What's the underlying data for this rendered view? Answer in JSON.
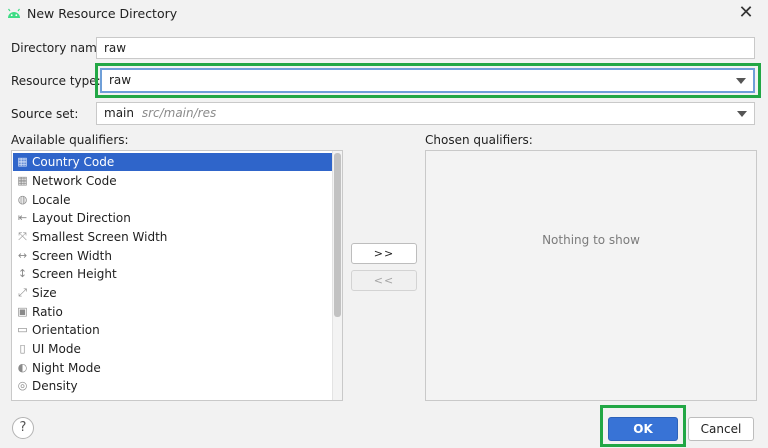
{
  "window": {
    "title": "New Resource Directory",
    "close_glyph": "✕",
    "app_icon": "android-icon"
  },
  "form": {
    "directory_name": {
      "label": "Directory name:",
      "value": "raw"
    },
    "resource_type": {
      "label": "Resource type:",
      "value": "raw"
    },
    "source_set": {
      "label": "Source set:",
      "value": "main",
      "path": "src/main/res"
    }
  },
  "available": {
    "label": "Available qualifiers:",
    "items": [
      {
        "label": "Country Code",
        "icon": "country-code-icon",
        "glyph": "▦",
        "selected": true
      },
      {
        "label": "Network Code",
        "icon": "network-code-icon",
        "glyph": "▦"
      },
      {
        "label": "Locale",
        "icon": "globe-icon",
        "glyph": "◍"
      },
      {
        "label": "Layout Direction",
        "icon": "layout-direction-icon",
        "glyph": "⇤"
      },
      {
        "label": "Smallest Screen Width",
        "icon": "smallest-width-icon",
        "glyph": "⤧"
      },
      {
        "label": "Screen Width",
        "icon": "screen-width-icon",
        "glyph": "↔"
      },
      {
        "label": "Screen Height",
        "icon": "screen-height-icon",
        "glyph": "↕"
      },
      {
        "label": "Size",
        "icon": "size-icon",
        "glyph": "⤢"
      },
      {
        "label": "Ratio",
        "icon": "ratio-icon",
        "glyph": "▣"
      },
      {
        "label": "Orientation",
        "icon": "orientation-icon",
        "glyph": "▭"
      },
      {
        "label": "UI Mode",
        "icon": "ui-mode-icon",
        "glyph": "▯"
      },
      {
        "label": "Night Mode",
        "icon": "night-mode-icon",
        "glyph": "◐"
      },
      {
        "label": "Density",
        "icon": "density-icon",
        "glyph": "◎"
      }
    ]
  },
  "move": {
    "add_label": ">>",
    "remove_label": "<<"
  },
  "chosen": {
    "label": "Chosen qualifiers:",
    "empty_text": "Nothing to show"
  },
  "footer": {
    "help_glyph": "?",
    "ok_label": "OK",
    "cancel_label": "Cancel"
  },
  "colors": {
    "highlight_annotation": "#22a745",
    "selection": "#2f65ca",
    "primary_button": "#3873d6"
  }
}
